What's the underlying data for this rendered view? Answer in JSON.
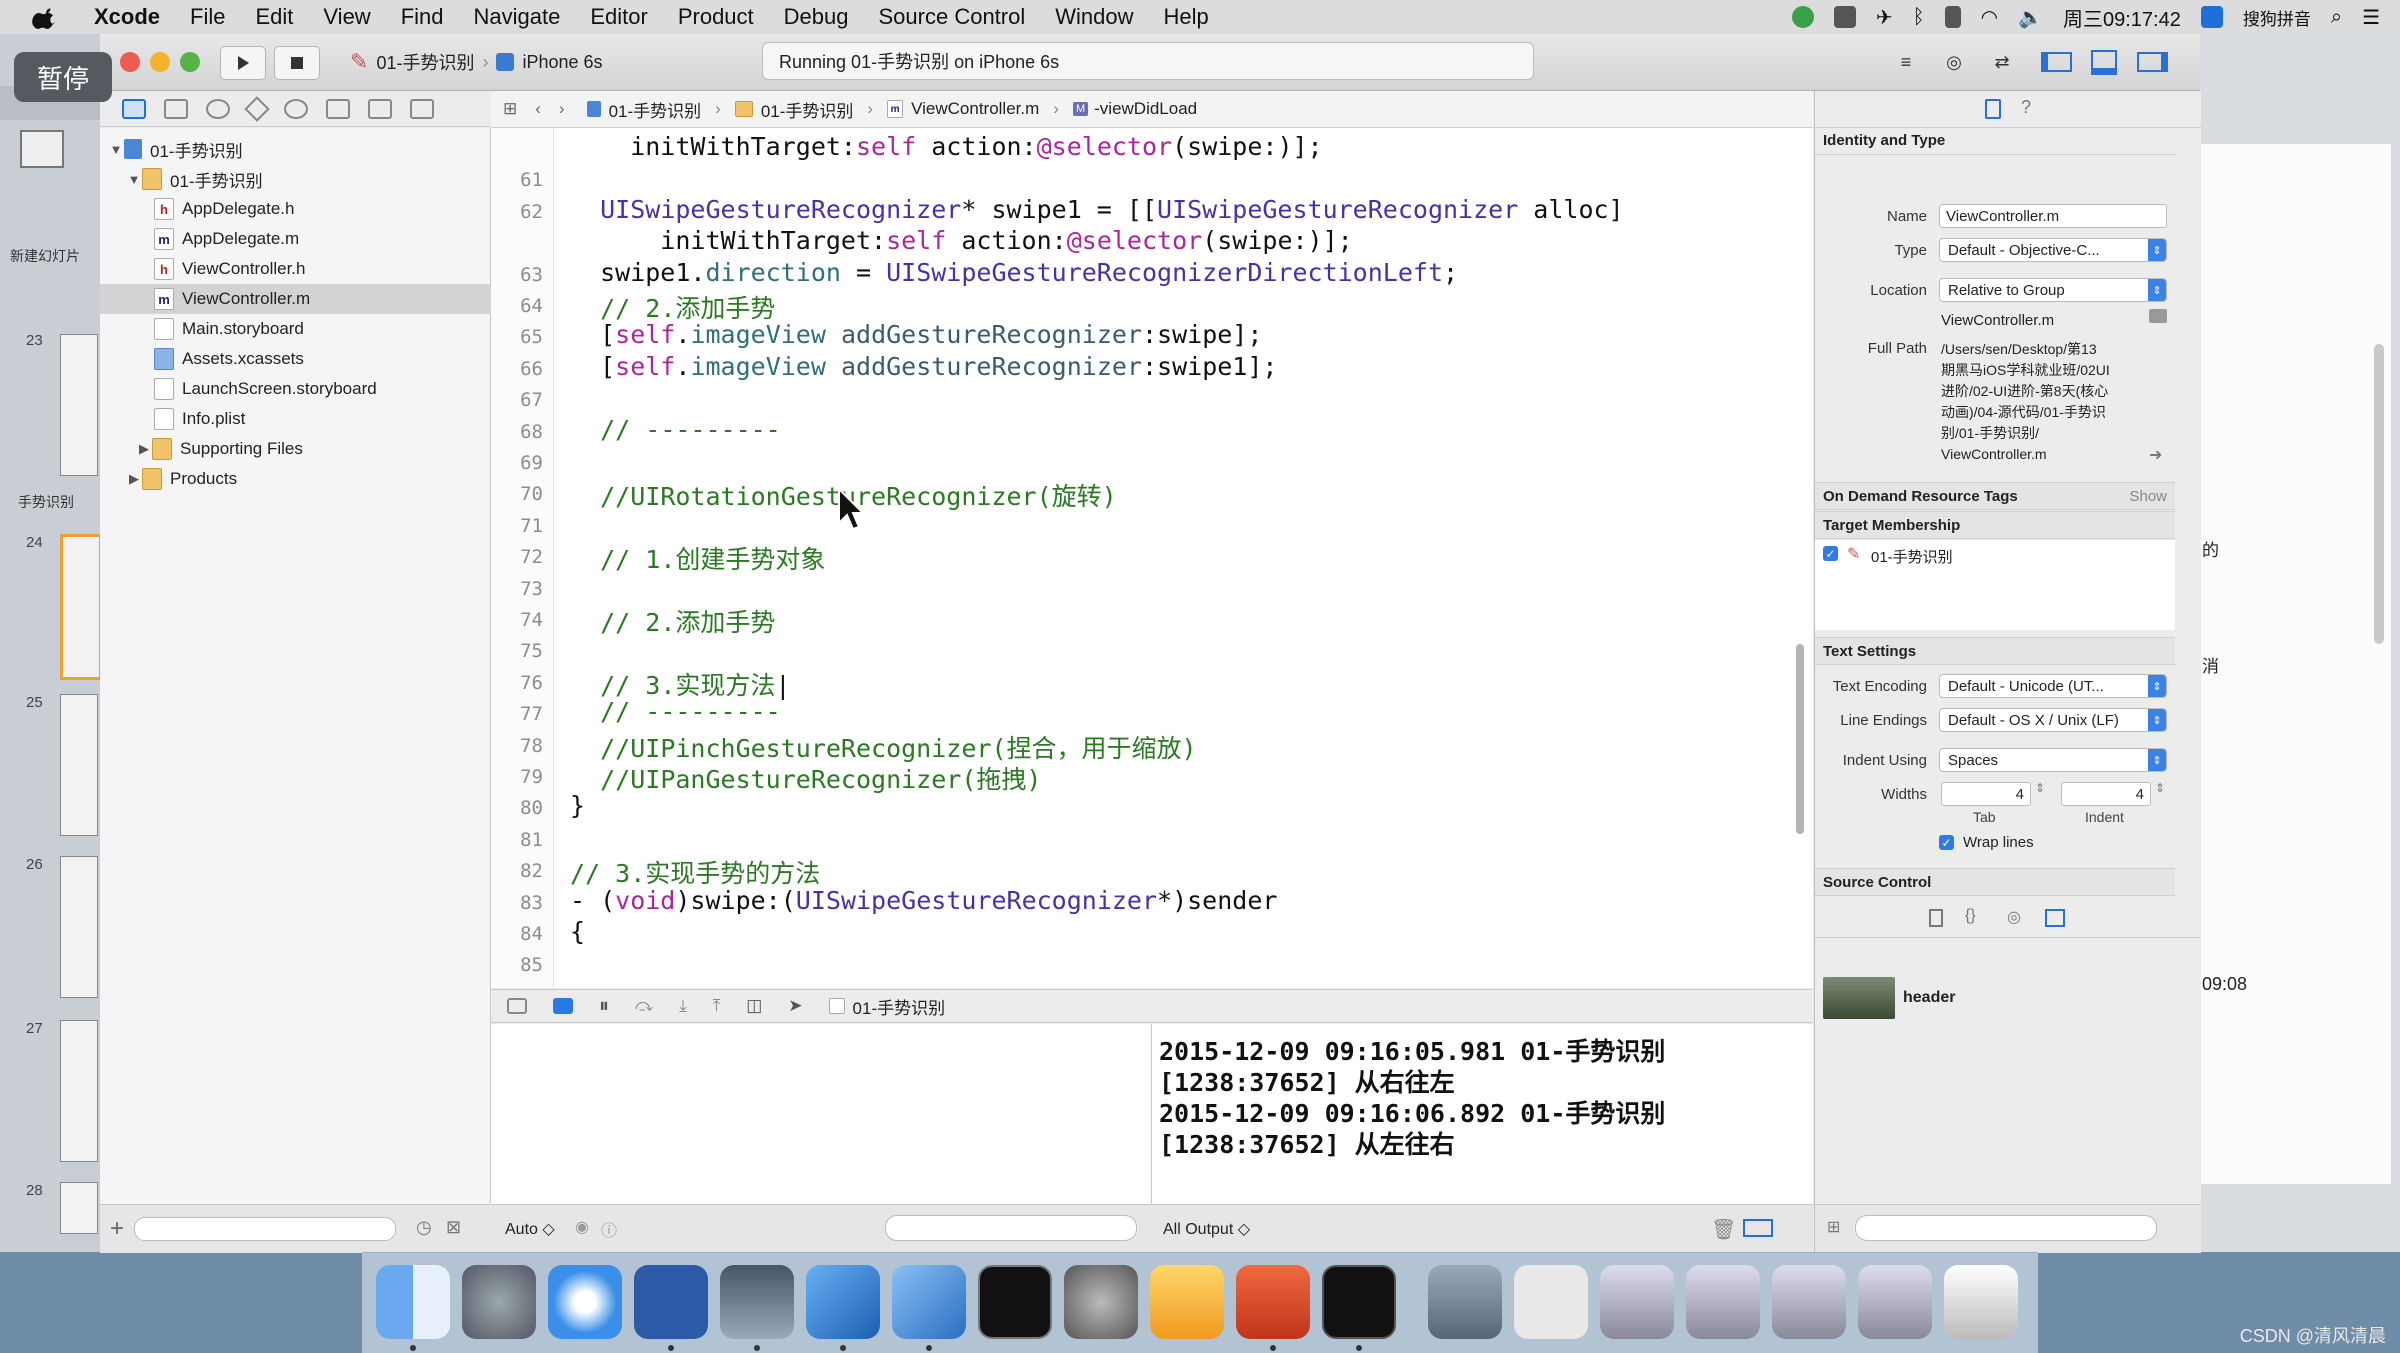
{
  "menubar": {
    "app": "Xcode",
    "items": [
      "File",
      "Edit",
      "View",
      "Find",
      "Navigate",
      "Editor",
      "Product",
      "Debug",
      "Source Control",
      "Window",
      "Help"
    ],
    "clock": "周三09:17:42",
    "input_method": "搜狗拼音"
  },
  "keynote": {
    "pause_label": "暂停",
    "new_slide_label": "新建幻灯片",
    "section_label": "手势识别",
    "slide_numbers": [
      "23",
      "24",
      "25",
      "26",
      "27",
      "28"
    ],
    "right_fragments": [
      "的",
      "消",
      "09:08"
    ]
  },
  "toolbar": {
    "scheme": "01-手势识别",
    "device": "iPhone 6s",
    "activity": "Running 01-手势识别 on iPhone 6s"
  },
  "navigator": {
    "items": [
      {
        "label": "01-手势识别",
        "kind": "proj",
        "indent": 0,
        "disclosure": "▼"
      },
      {
        "label": "01-手势识别",
        "kind": "folder",
        "indent": 1,
        "disclosure": "▼"
      },
      {
        "label": "AppDelegate.h",
        "kind": "h",
        "indent": 2,
        "disclosure": ""
      },
      {
        "label": "AppDelegate.m",
        "kind": "m",
        "indent": 2,
        "disclosure": ""
      },
      {
        "label": "ViewController.h",
        "kind": "h",
        "indent": 2,
        "disclosure": ""
      },
      {
        "label": "ViewController.m",
        "kind": "m",
        "indent": 2,
        "disclosure": "",
        "selected": true
      },
      {
        "label": "Main.storyboard",
        "kind": "sb",
        "indent": 2,
        "disclosure": ""
      },
      {
        "label": "Assets.xcassets",
        "kind": "assets",
        "indent": 2,
        "disclosure": ""
      },
      {
        "label": "LaunchScreen.storyboard",
        "kind": "sb",
        "indent": 2,
        "disclosure": ""
      },
      {
        "label": "Info.plist",
        "kind": "sb",
        "indent": 2,
        "disclosure": ""
      },
      {
        "label": "Supporting Files",
        "kind": "folder",
        "indent": 2,
        "disclosure": "▶"
      },
      {
        "label": "Products",
        "kind": "folder",
        "indent": 1,
        "disclosure": "▶"
      }
    ]
  },
  "jumpbar": {
    "segments": [
      "01-手势识别",
      "01-手势识别",
      "ViewController.m",
      "-viewDidLoad"
    ]
  },
  "editor": {
    "lines": [
      {
        "num": "",
        "html": "    initWithTarget:<span class=\"kw\">self</span> action:<span class=\"kw\">@selector</span>(swipe:)];"
      },
      {
        "num": "61",
        "html": ""
      },
      {
        "num": "62",
        "html": "  <span class=\"cls\">UISwipeGestureRecognizer</span>* swipe1 = [[<span class=\"cls\">UISwipeGestureRecognizer</span> alloc]"
      },
      {
        "num": "",
        "html": "      initWithTarget:<span class=\"kw\">self</span> action:<span class=\"kw\">@selector</span>(swipe:)];"
      },
      {
        "num": "63",
        "html": "  swipe1.<span class=\"prop\">direction</span> = <span class=\"cls\">UISwipeGestureRecognizerDirectionLeft</span>;"
      },
      {
        "num": "64",
        "html": "  <span class=\"cmt\">// 2.添加手势</span>"
      },
      {
        "num": "65",
        "html": "  [<span class=\"kw\">self</span>.<span class=\"prop\">imageView</span> <span class=\"fn\">addGestureRecognizer</span>:swipe];"
      },
      {
        "num": "66",
        "html": "  [<span class=\"kw\">self</span>.<span class=\"prop\">imageView</span> <span class=\"fn\">addGestureRecognizer</span>:swipe1];"
      },
      {
        "num": "67",
        "html": ""
      },
      {
        "num": "68",
        "html": "  <span class=\"cmt\">// ---------</span>"
      },
      {
        "num": "69",
        "html": ""
      },
      {
        "num": "70",
        "html": "  <span class=\"cmt\">//UIRotationGestureRecognizer(旋转)</span>"
      },
      {
        "num": "71",
        "html": ""
      },
      {
        "num": "72",
        "html": "  <span class=\"cmt\">// 1.创建手势对象</span>"
      },
      {
        "num": "73",
        "html": ""
      },
      {
        "num": "74",
        "html": "  <span class=\"cmt\">// 2.添加手势</span>"
      },
      {
        "num": "75",
        "html": ""
      },
      {
        "num": "76",
        "html": "  <span class=\"cmt\">// 3.实现方法</span>|"
      },
      {
        "num": "77",
        "html": "  <span class=\"cmt\">// ---------</span>"
      },
      {
        "num": "78",
        "html": "  <span class=\"cmt\">//UIPinchGestureRecognizer(捏合，用于缩放)</span>"
      },
      {
        "num": "79",
        "html": "  <span class=\"cmt\">//UIPanGestureRecognizer(拖拽)</span>"
      },
      {
        "num": "80",
        "html": "}"
      },
      {
        "num": "81",
        "html": ""
      },
      {
        "num": "82",
        "html": "<span class=\"cmt\">// 3.实现手势的方法</span>"
      },
      {
        "num": "83",
        "html": "- (<span class=\"kw\">void</span>)swipe:(<span class=\"cls\">UISwipeGestureRecognizer</span>*)sender"
      },
      {
        "num": "84",
        "html": "{"
      },
      {
        "num": "85",
        "html": ""
      }
    ]
  },
  "debug": {
    "target": "01-手势识别",
    "auto_label": "Auto ◇",
    "output_label": "All Output ◇",
    "console_lines": [
      "2015-12-09 09:16:05.981 01-手势识别",
      "[1238:37652] 从右往左",
      "2015-12-09 09:16:06.892 01-手势识别",
      "[1238:37652] 从左往右"
    ]
  },
  "inspector": {
    "identity_head": "Identity and Type",
    "name_label": "Name",
    "name_value": "ViewController.m",
    "type_label": "Type",
    "type_value": "Default - Objective-C...",
    "location_label": "Location",
    "location_value": "Relative to Group",
    "location_file": "ViewController.m",
    "fullpath_label": "Full Path",
    "fullpath_lines": [
      "/Users/sen/Desktop/第13",
      "期黑马iOS学科就业班/02UI",
      "进阶/02-UI进阶-第8天(核心",
      "动画)/04-源代码/01-手势识",
      "别/01-手势识别/",
      "ViewController.m"
    ],
    "ondemand_head": "On Demand Resource Tags",
    "ondemand_show": "Show",
    "target_head": "Target Membership",
    "target_item": "01-手势识别",
    "text_head": "Text Settings",
    "encoding_label": "Text Encoding",
    "encoding_value": "Default - Unicode (UT...",
    "endings_label": "Line Endings",
    "endings_value": "Default - OS X / Unix (LF)",
    "indent_label": "Indent Using",
    "indent_value": "Spaces",
    "widths_label": "Widths",
    "tab_value": "4",
    "indent_width_value": "4",
    "tab_caption": "Tab",
    "indent_caption": "Indent",
    "wrap_label": "Wrap lines",
    "source_head": "Source Control",
    "header_label": "header"
  },
  "watermark": "CSDN @清风清晨",
  "colors": {
    "keyword": "#b0239b",
    "class": "#4b2fa6",
    "comment": "#2a7a22",
    "accent": "#2f7be6"
  }
}
